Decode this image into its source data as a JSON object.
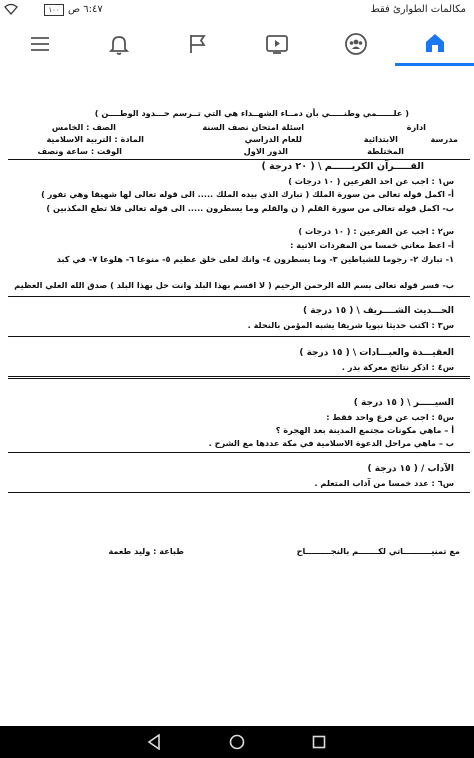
{
  "status_bar": {
    "title": "مكالمات الطوارئ فقط",
    "time": "٦:٤٧ ص",
    "battery": "١٠٠"
  },
  "nav": {
    "items": [
      {
        "name": "home-icon",
        "active": true
      },
      {
        "name": "groups-icon",
        "active": false
      },
      {
        "name": "video-icon",
        "active": false
      },
      {
        "name": "flag-icon",
        "active": false
      },
      {
        "name": "bell-icon",
        "active": false
      },
      {
        "name": "menu-icon",
        "active": false
      }
    ]
  },
  "doc": {
    "motto": "( علــــــمي وطنـــــي بأن دمــاء الشهــداء هي التي تــرسم حـــدود الوطــــن )",
    "admin": "ادارة",
    "exam": "اسئلة امتحان نصف السنة",
    "grade": "الصف : الخامس",
    "school": "مدرسة",
    "school_type": "الابتدائية",
    "year": "للعام الدراسي",
    "subject": "المادة : التربية الاسلامية",
    "mixed": "المختلطة",
    "round": "الدور الاول",
    "time": "الوقت : ساعة ونصف",
    "quran_head": "القـــــرآن الكريــــــم \\  ( ٢٠ درجة )",
    "q1": "س١ : اجب عن احد الفرعين ( ١٠ درجات )",
    "q1a": "أ- اكمل قوله تعالى من سورة الملك ( تبارك الذي بيده الملك ..... الى قوله تعالى لها شهيقا وهي تفور )",
    "q1b": "ب- اكمل قوله تعالى من سورة القلم ( ن والقلم وما يسطرون ..... الى قوله تعالى فلا تطع المكذبين )",
    "q2": "س٢ : اجب عن الفرعين : ( ١٠ درجات )",
    "q2a": "أ- اعط معاني خمسا من المفردات الاتية :",
    "q2a_words": "١- تبارك  ٢- رجوما للشياطين  ٣- وما يسطرون   ٤- وانك لعلى خلق عظيم  ٥- منوعا  ٦- هلوعا  ٧- في كبد",
    "q2b": "ب- فسر قوله تعالى بسم الله الرحمن الرحيم ( لا اقسم بهذا البلد وانت حل بهذا البلد ) صدق الله العلي العظيم",
    "hadith_head": "الحـــديث الشــــريف \\  ( ١٥ درجة )",
    "q3": "س٣ : اكتب حديثا نبويا شريفا يشبه المؤمن بالنحلة .",
    "aqeeda_head": "العقيـــدة والعبـــادات \\  ( ١٥ درجة )",
    "q4": "س٤ : اذكر نتائج معركة بدر .",
    "seera_head": "السيـــــر  \\ ( ١٥ درجة )",
    "q5": "س٥ : اجب عن فرع واحد فقط :",
    "q5a": "أ – ماهي مكونات مجتمع المدينة بعد الهجرة ؟",
    "q5b": "ب – ماهي مراحل الدعوة الاسلامية في مكة عددها مع الشرح .",
    "adab_head": "الآداب /  ( ١٥ درجة )",
    "q6": "س٦ : عدد خمسا من آداب المتعلم .",
    "wish": "مع تمنيــــــــــاتي لكـــــــم  بالنجـــــــــاح",
    "typing": "طباعة : وليد طعمة"
  },
  "bottom_nav": {
    "items": [
      "back-icon",
      "home-circle-icon",
      "recents-icon"
    ]
  }
}
